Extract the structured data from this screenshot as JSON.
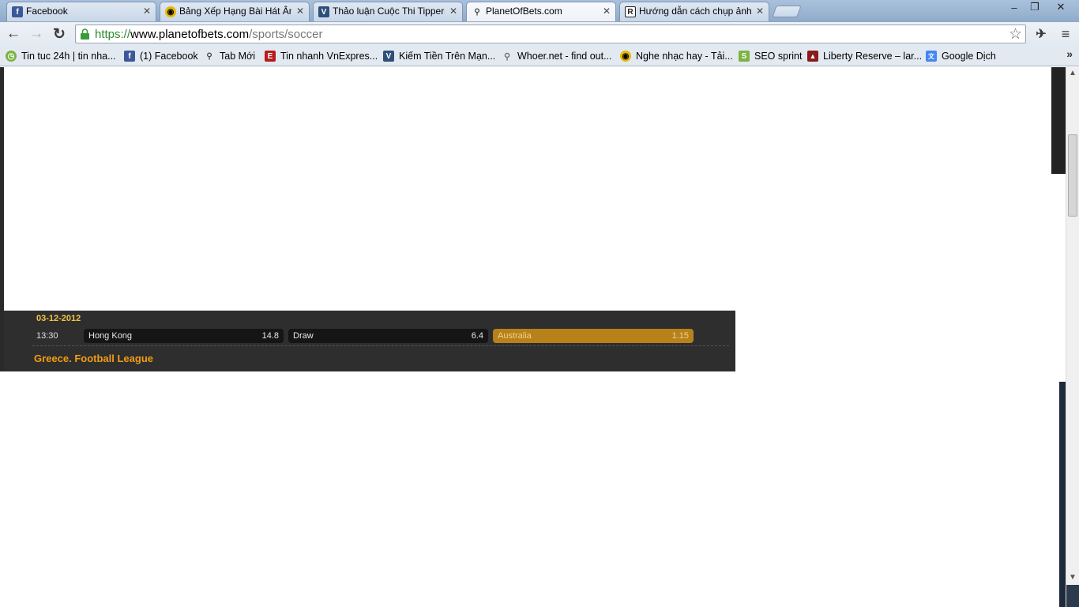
{
  "browser": {
    "tabs": [
      {
        "title": "Facebook",
        "favicon_color": "#3b5998",
        "favicon_glyph": "f"
      },
      {
        "title": "Bảng Xếp Hạng Bài Hát Âm Nhạc",
        "favicon_color": "#e6b800",
        "favicon_glyph": "◉"
      },
      {
        "title": "Thảo luận Cuộc Thi Tippers",
        "favicon_color": "#2d4f7a",
        "favicon_glyph": "V"
      },
      {
        "title": "PlanetOfBets.com",
        "favicon_color": "#555555",
        "favicon_glyph": "⚲"
      },
      {
        "title": "Hướng dẫn cách chụp ảnh",
        "favicon_color": "#222222",
        "favicon_glyph": "R"
      }
    ],
    "active_tab_index": 3,
    "url": {
      "scheme": "https://",
      "host": "www.planetofbets.com",
      "path": "/sports/soccer"
    },
    "bookmarks": [
      {
        "label": "Tin tuc 24h | tin nha...",
        "icon_color": "#7cb342",
        "glyph": "◷"
      },
      {
        "label": "(1) Facebook",
        "icon_color": "#3b5998",
        "glyph": "f"
      },
      {
        "label": "Tab Mới",
        "icon_color": "#777777",
        "glyph": "⚲"
      },
      {
        "label": "Tin nhanh VnExpres...",
        "icon_color": "#b71c1c",
        "glyph": "E"
      },
      {
        "label": "Kiếm Tiền Trên Mạn...",
        "icon_color": "#2d4f7a",
        "glyph": "V"
      },
      {
        "label": "Whoer.net - find out...",
        "icon_color": "#9e9e9e",
        "glyph": "🔍"
      },
      {
        "label": "Nghe nhạc hay - Tải...",
        "icon_color": "#e6b800",
        "glyph": "◉"
      },
      {
        "label": "SEO sprint",
        "icon_color": "#7cb342",
        "glyph": "S"
      },
      {
        "label": "Liberty Reserve – lar...",
        "icon_color": "#8b1a1a",
        "glyph": "▲"
      },
      {
        "label": "Google Dịch",
        "icon_color": "#4285f4",
        "glyph": "文"
      }
    ],
    "bookmarks_overflow": "»",
    "window_controls": {
      "minimize": "–",
      "restore": "❐",
      "close": "✕"
    }
  },
  "match": {
    "date": "03-12-2012",
    "time": "13:30",
    "home": {
      "label": "Hong Kong",
      "odds": "14.8"
    },
    "draw": {
      "label": "Draw",
      "odds": "6.4"
    },
    "away": {
      "label": "Australia",
      "odds": "1.15",
      "selected": true
    }
  },
  "league": "Greece. Football League",
  "colors": {
    "accent": "#f39c12",
    "panel_bg": "#2e2e2e",
    "selected_odds": "#b8811a",
    "date_color": "#f5c542"
  }
}
